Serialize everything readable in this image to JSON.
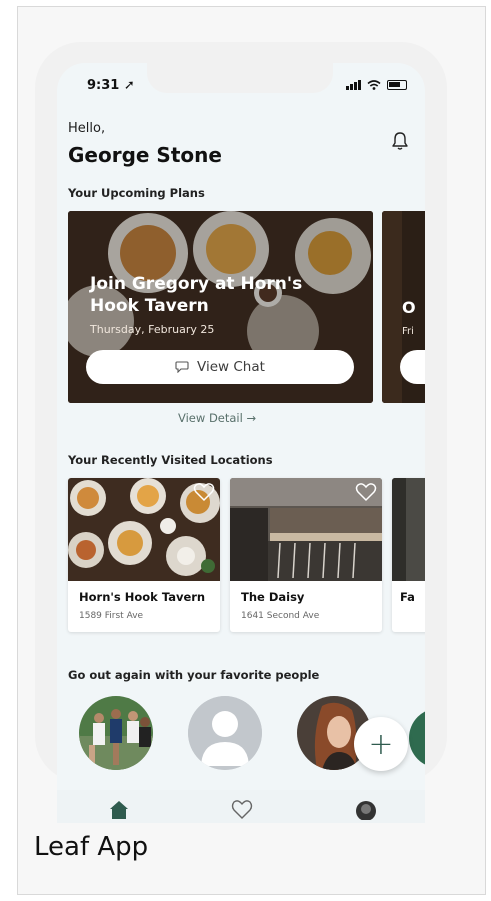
{
  "status_bar": {
    "time": "9:31"
  },
  "header": {
    "greeting": "Hello,",
    "user_name": "George Stone"
  },
  "plans": {
    "section_title": "Your Upcoming Plans",
    "card": {
      "title": "Join Gregory at Horn's Hook Tavern",
      "date": "Thursday, February 25",
      "chat_button_label": "View Chat"
    },
    "peek_card": {
      "title": "O",
      "date": "Fri"
    },
    "view_detail_label": "View Detail →"
  },
  "recent": {
    "section_title": "Your Recently Visited Locations",
    "locations": [
      {
        "name": "Horn's Hook Tavern",
        "address": "1589 First Ave"
      },
      {
        "name": "The Daisy",
        "address": "1641 Second Ave"
      },
      {
        "name": "Fa",
        "address": ""
      }
    ]
  },
  "people": {
    "section_title": "Go out again with your favorite people",
    "add_label": "+"
  },
  "caption": "Leaf App",
  "colors": {
    "accent": "#2f5b4e",
    "background": "#f1f6f8"
  }
}
